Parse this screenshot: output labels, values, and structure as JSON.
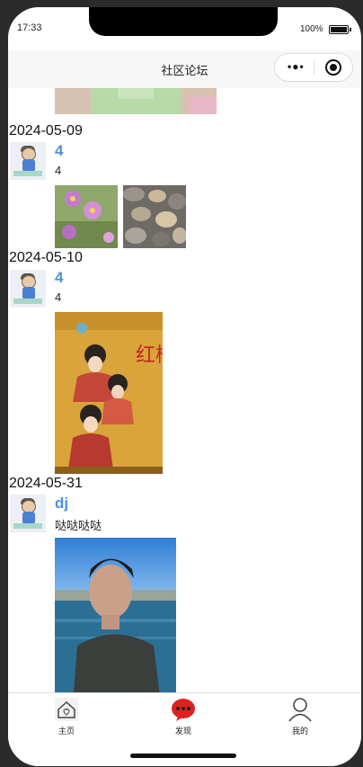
{
  "status_bar": {
    "time": "17:33",
    "battery": "100%"
  },
  "nav": {
    "title": "社区论坛"
  },
  "posts": [
    {
      "date": "2024-05-09",
      "user": "4",
      "text": "4"
    },
    {
      "date": "2024-05-10",
      "user": "4",
      "text": "4"
    },
    {
      "date": "2024-05-31",
      "user": "dj",
      "text": "哒哒哒哒"
    }
  ],
  "tabs": [
    {
      "label": "主页",
      "icon": "home-icon"
    },
    {
      "label": "发现",
      "icon": "chat-bubble-icon"
    },
    {
      "label": "我的",
      "icon": "user-icon"
    }
  ],
  "poster_text": "红楼梦"
}
